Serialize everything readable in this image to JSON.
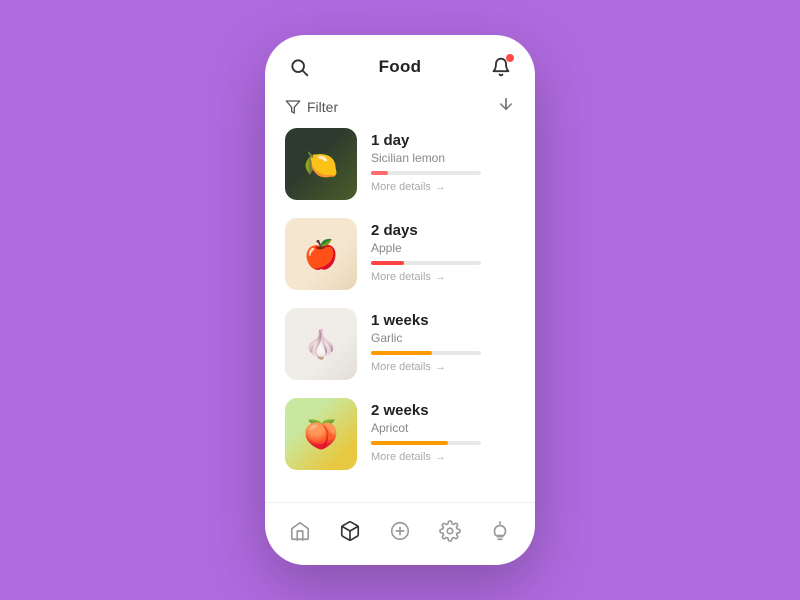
{
  "header": {
    "title": "Food",
    "notification_count": 1
  },
  "filter": {
    "label": "Filter",
    "sort_icon": "↕"
  },
  "food_items": [
    {
      "id": "lemon",
      "duration": "1 day",
      "name": "Sicilian lemon",
      "progress": 15,
      "progress_color": "#ff6b6b",
      "more_details": "More details",
      "emoji": "🍋",
      "img_class": "img-lemon"
    },
    {
      "id": "apple",
      "duration": "2 days",
      "name": "Apple",
      "progress": 30,
      "progress_color": "#ff4444",
      "more_details": "More details",
      "emoji": "🍎",
      "img_class": "img-apple"
    },
    {
      "id": "garlic",
      "duration": "1 weeks",
      "name": "Garlic",
      "progress": 55,
      "progress_color": "#ff9900",
      "more_details": "More details",
      "emoji": "🧄",
      "img_class": "img-garlic"
    },
    {
      "id": "apricot",
      "duration": "2 weeks",
      "name": "Apricot",
      "progress": 70,
      "progress_color": "#ff9900",
      "more_details": "More details",
      "emoji": "🍑",
      "img_class": "img-apricot"
    }
  ],
  "bottom_nav": {
    "items": [
      {
        "id": "home",
        "label": "Home",
        "active": false
      },
      {
        "id": "box",
        "label": "Box",
        "active": true
      },
      {
        "id": "add",
        "label": "Add",
        "active": false
      },
      {
        "id": "settings",
        "label": "Settings",
        "active": false
      },
      {
        "id": "idea",
        "label": "Idea",
        "active": false
      }
    ]
  }
}
